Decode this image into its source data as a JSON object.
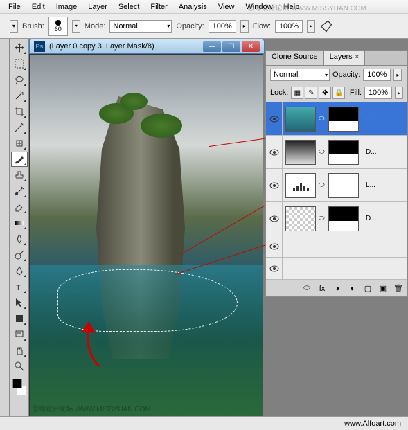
{
  "menu": {
    "items": [
      "File",
      "Edit",
      "Image",
      "Layer",
      "Select",
      "Filter",
      "Analysis",
      "View",
      "Window",
      "Help"
    ]
  },
  "options_bar": {
    "brush_label": "Brush:",
    "brush_size": "60",
    "mode_label": "Mode:",
    "mode_value": "Normal",
    "opacity_label": "Opacity:",
    "opacity_value": "100%",
    "flow_label": "Flow:",
    "flow_value": "100%"
  },
  "document": {
    "title": "(Layer 0 copy 3, Layer Mask/8)",
    "ps_badge": "Ps"
  },
  "panels": {
    "tabs": [
      {
        "label": "Clone Source",
        "active": false
      },
      {
        "label": "Layers",
        "active": true,
        "closable": true
      }
    ],
    "blend_mode": "Normal",
    "opacity_label": "Opacity:",
    "opacity_value": "100%",
    "lock_label": "Lock:",
    "fill_label": "Fill:",
    "fill_value": "100%",
    "layers": [
      {
        "name": "...",
        "selected": true,
        "visible": true,
        "has_mask": true,
        "thumb": "ocean"
      },
      {
        "name": "D...",
        "selected": false,
        "visible": true,
        "has_mask": true,
        "thumb": "bw1"
      },
      {
        "name": "L...",
        "selected": false,
        "visible": true,
        "has_mask": true,
        "thumb": "levels"
      },
      {
        "name": "D...",
        "selected": false,
        "visible": true,
        "has_mask": true,
        "thumb": "bw2"
      },
      {
        "name": "",
        "selected": false,
        "visible": true,
        "has_mask": false,
        "thumb": "blank"
      },
      {
        "name": "",
        "selected": false,
        "visible": true,
        "has_mask": false,
        "thumb": "blank"
      }
    ]
  },
  "status": {
    "credit": "www.Alfoart.com"
  },
  "watermarks": {
    "top": "思缘设计论坛 WWW.MISSYUAN.COM",
    "bottom": "思缘设计论坛 WWW.MISSYUAN.COM"
  },
  "tools": [
    "move",
    "marquee",
    "lasso",
    "wand",
    "crop",
    "eyedrop",
    "heal",
    "brush",
    "stamp",
    "history",
    "eraser",
    "gradient",
    "blur",
    "dodge",
    "pen",
    "type",
    "path",
    "rect",
    "notes",
    "hand",
    "zoom"
  ]
}
